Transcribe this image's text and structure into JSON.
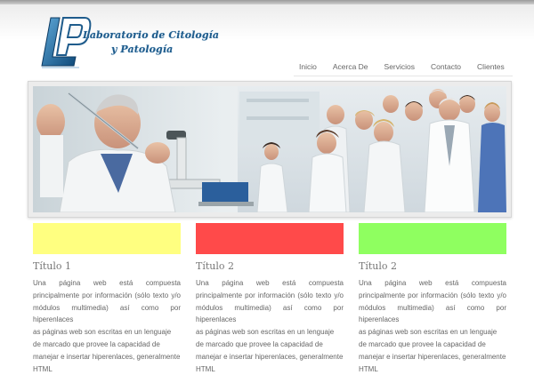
{
  "colors": {
    "accent": "#1f5c8c",
    "swatch_yellow": "#ffff80",
    "swatch_red": "#ff4a4a",
    "swatch_green": "#8fff60"
  },
  "logo": {
    "line1": "Laboratorio de Citología",
    "line2": "y Patología",
    "icon": "lp-monogram-icon"
  },
  "nav": {
    "items": [
      "Inicio",
      "Acerca De",
      "Servicios",
      "Contacto",
      "Clientes"
    ]
  },
  "banner": {
    "image": "lab-scientists-banner"
  },
  "columns": [
    {
      "title": "Título 1",
      "text1": "Una página web está compuesta principalmente por información (sólo texto y/o módulos multimedia) así como por hiperenlaces",
      "text2": "as páginas web son escritas en un lenguaje de marcado que provee la capacidad de manejar e insertar hiperenlaces, generalmente HTML"
    },
    {
      "title": "Título 2",
      "text1": "Una página web está compuesta principalmente por información (sólo texto y/o módulos multimedia) así como por hiperenlaces",
      "text2": "as páginas web son escritas en un lenguaje de marcado que provee la capacidad de manejar e insertar hiperenlaces, generalmente HTML"
    },
    {
      "title": "Título 2",
      "text1": "Una página web está compuesta principalmente por información (sólo texto y/o módulos multimedia) así como por hiperenlaces",
      "text2": "as páginas web son escritas en un lenguaje de marcado que provee la capacidad de manejar e insertar hiperenlaces, generalmente HTML"
    }
  ]
}
